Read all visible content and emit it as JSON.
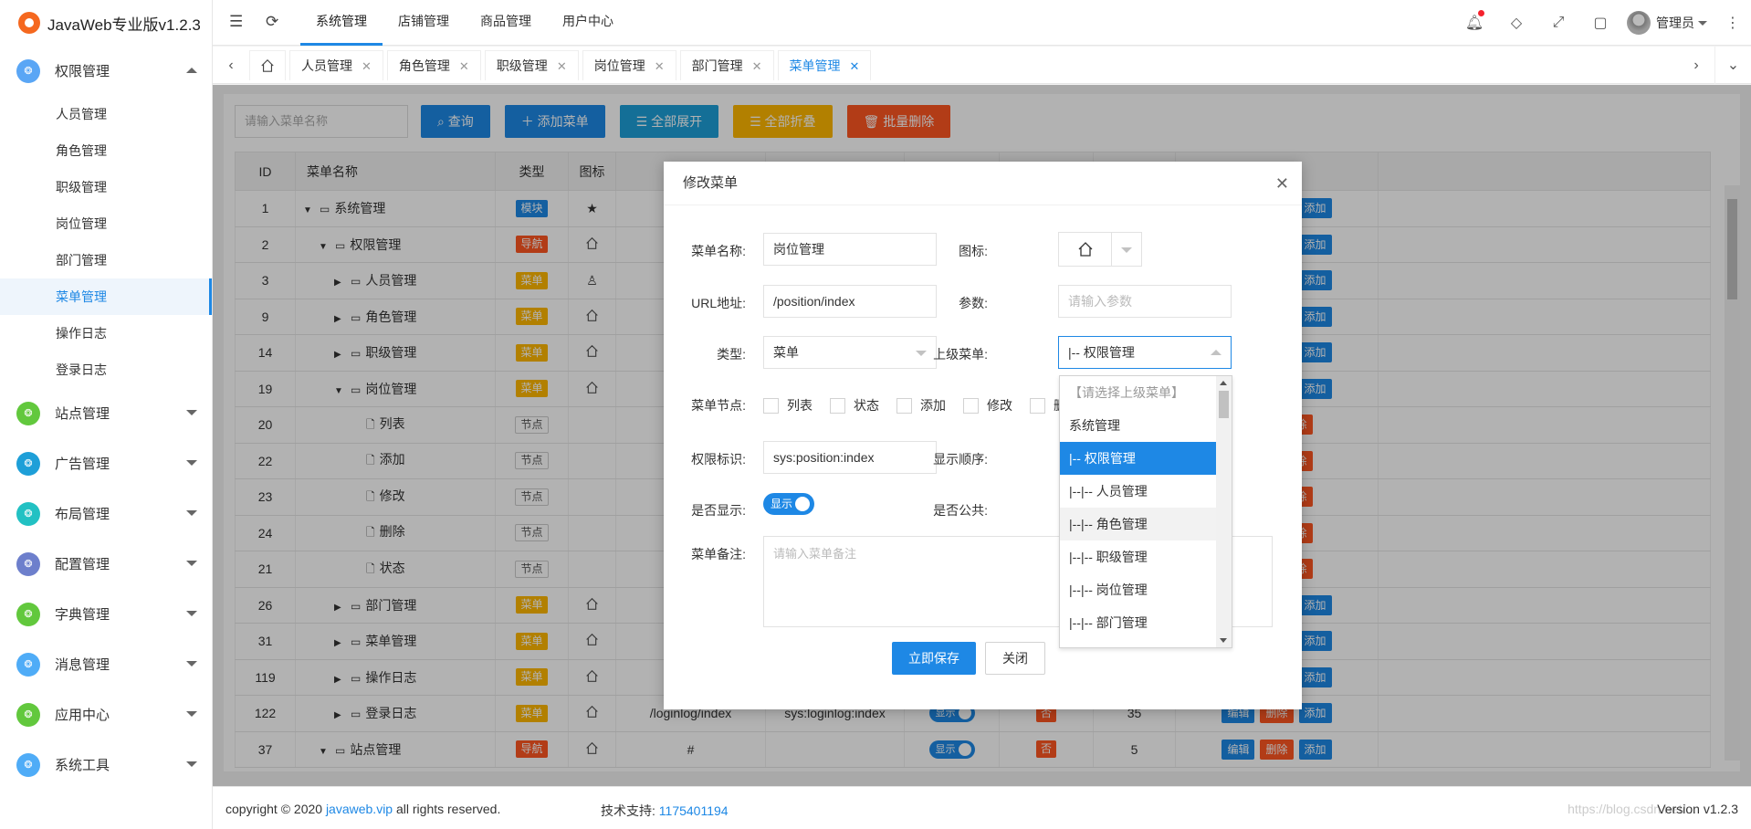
{
  "app": {
    "title": "JavaWeb专业版v1.2.3"
  },
  "sidebar": {
    "groups": [
      {
        "label": "权限管理",
        "color": "#5aa6f5",
        "expanded": true
      },
      {
        "label": "站点管理",
        "color": "#62c83d"
      },
      {
        "label": "广告管理",
        "color": "#1e9fd8"
      },
      {
        "label": "布局管理",
        "color": "#22c1c3"
      },
      {
        "label": "配置管理",
        "color": "#6d7fcc"
      },
      {
        "label": "字典管理",
        "color": "#62c83d"
      },
      {
        "label": "消息管理",
        "color": "#4facf7"
      },
      {
        "label": "应用中心",
        "color": "#62c83d"
      },
      {
        "label": "系统工具",
        "color": "#4facf7"
      }
    ],
    "subitems": [
      "人员管理",
      "角色管理",
      "职级管理",
      "岗位管理",
      "部门管理",
      "菜单管理",
      "操作日志",
      "登录日志"
    ],
    "active_subitem": "菜单管理"
  },
  "header": {
    "nav": [
      "系统管理",
      "店铺管理",
      "商品管理",
      "用户中心"
    ],
    "user": "管理员"
  },
  "tabs": [
    "人员管理",
    "角色管理",
    "职级管理",
    "岗位管理",
    "部门管理",
    "菜单管理"
  ],
  "toolbar": {
    "search_placeholder": "请输入菜单名称",
    "query": "查询",
    "add": "添加菜单",
    "expand": "全部展开",
    "collapse": "全部折叠",
    "batch_delete": "批量删除"
  },
  "table": {
    "headers": [
      "ID",
      "菜单名称",
      "类型",
      "图标"
    ],
    "rows": [
      {
        "id": "1",
        "name": "系统管理",
        "type": "模块",
        "cls": "b-mod",
        "level": 0,
        "ops": true
      },
      {
        "id": "2",
        "name": "权限管理",
        "type": "导航",
        "cls": "b-nav",
        "level": 1,
        "ops": true
      },
      {
        "id": "3",
        "name": "人员管理",
        "type": "菜单",
        "cls": "b-menu",
        "level": 2,
        "ops": true
      },
      {
        "id": "9",
        "name": "角色管理",
        "type": "菜单",
        "cls": "b-menu",
        "level": 2,
        "ops": true
      },
      {
        "id": "14",
        "name": "职级管理",
        "type": "菜单",
        "cls": "b-menu",
        "level": 2,
        "ops": true
      },
      {
        "id": "19",
        "name": "岗位管理",
        "type": "菜单",
        "cls": "b-menu",
        "level": 2,
        "ops": true
      },
      {
        "id": "20",
        "name": "列表",
        "type": "节点",
        "cls": "b-node",
        "level": 3,
        "ops": false
      },
      {
        "id": "22",
        "name": "添加",
        "type": "节点",
        "cls": "b-node",
        "level": 3,
        "ops": false
      },
      {
        "id": "23",
        "name": "修改",
        "type": "节点",
        "cls": "b-node",
        "level": 3,
        "ops": false
      },
      {
        "id": "24",
        "name": "删除",
        "type": "节点",
        "cls": "b-node",
        "level": 3,
        "ops": false
      },
      {
        "id": "21",
        "name": "状态",
        "type": "节点",
        "cls": "b-node",
        "level": 3,
        "ops": false
      },
      {
        "id": "26",
        "name": "部门管理",
        "type": "菜单",
        "cls": "b-menu",
        "level": 2,
        "ops": true
      },
      {
        "id": "31",
        "name": "菜单管理",
        "type": "菜单",
        "cls": "b-menu",
        "level": 2,
        "ops": true
      },
      {
        "id": "119",
        "name": "操作日志",
        "type": "菜单",
        "cls": "b-menu",
        "level": 2,
        "ops": true
      },
      {
        "id": "122",
        "name": "登录日志",
        "type": "菜单",
        "cls": "b-menu",
        "level": 2,
        "ops": true,
        "url": "/loginlog/index",
        "perm": "sys:loginlog:index",
        "show": "显示",
        "public": "否",
        "sort": "35"
      },
      {
        "id": "37",
        "name": "站点管理",
        "type": "导航",
        "cls": "b-nav",
        "level": 1,
        "ops": true,
        "url": "#",
        "show": "显示",
        "public": "否",
        "sort": "5"
      }
    ],
    "ops": {
      "edit": "编辑",
      "delete": "删除",
      "add": "添加"
    }
  },
  "modal": {
    "title": "修改菜单",
    "name_label": "菜单名称:",
    "name_value": "岗位管理",
    "icon_label": "图标:",
    "url_label": "URL地址:",
    "url_value": "/position/index",
    "param_label": "参数:",
    "param_placeholder": "请输入参数",
    "type_label": "类型:",
    "type_value": "菜单",
    "parent_label": "上级菜单:",
    "parent_value": "|-- 权限管理",
    "node_label": "菜单节点:",
    "nodes": [
      "列表",
      "状态",
      "添加",
      "修改",
      "删"
    ],
    "perm_label": "权限标识:",
    "perm_value": "sys:position:index",
    "sort_label": "显示顺序:",
    "show_label": "是否显示:",
    "show_value": "显示",
    "public_label": "是否公共:",
    "remark_label": "菜单备注:",
    "remark_placeholder": "请输入菜单备注",
    "save": "立即保存",
    "close": "关闭"
  },
  "dropdown": {
    "options": [
      "【请选择上级菜单】",
      "系统管理",
      "|-- 权限管理",
      "|--|-- 人员管理",
      "|--|-- 角色管理",
      "|--|-- 职级管理",
      "|--|-- 岗位管理",
      "|--|-- 部门管理"
    ],
    "selected_index": 2,
    "hover_index": 4
  },
  "footer": {
    "copy_prefix": "copyright © 2020 ",
    "copy_link": "javaweb.vip",
    "copy_suffix": " all rights reserved.",
    "support_label": "技术支持: ",
    "support_value": "1175401194",
    "watermark": "https://blog.csdn.net/...",
    "version": "Version v1.2.3"
  }
}
